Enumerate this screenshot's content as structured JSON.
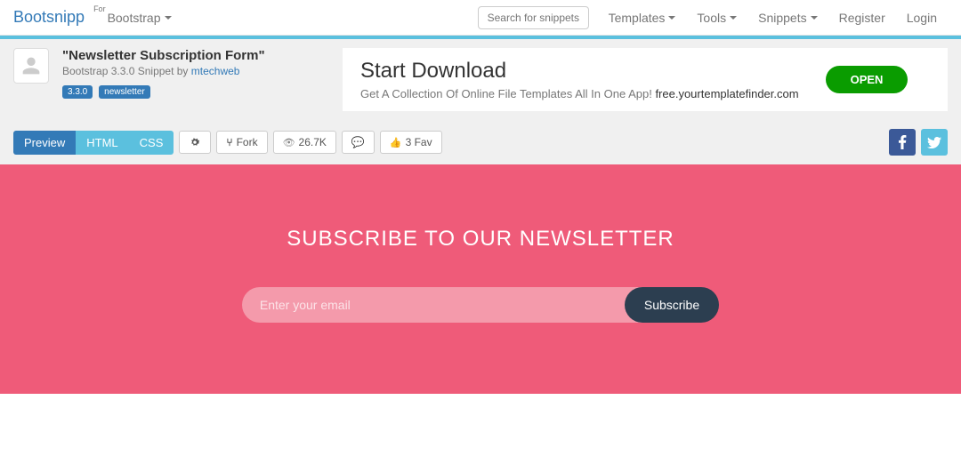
{
  "nav": {
    "brand": "Bootsnipp",
    "for": "For",
    "bootstrap": "Bootstrap",
    "search_placeholder": "Search for snippets",
    "items": [
      "Templates",
      "Tools",
      "Snippets",
      "Register",
      "Login"
    ]
  },
  "snippet": {
    "title": "\"Newsletter Subscription Form\"",
    "sub_prefix": "Bootstrap 3.3.0 Snippet by ",
    "author": "mtechweb",
    "tags": [
      "3.3.0",
      "newsletter"
    ]
  },
  "ad": {
    "title": "Start Download",
    "text": "Get A Collection Of Online File Templates All In One App! ",
    "domain": "free.yourtemplatefinder.com",
    "cta": "OPEN"
  },
  "toolbar": {
    "preview": "Preview",
    "html": "HTML",
    "css": "CSS",
    "fork": "Fork",
    "views": "26.7K",
    "fav": "3 Fav"
  },
  "preview": {
    "heading": "SUBSCRIBE TO OUR NEWSLETTER",
    "placeholder": "Enter your email",
    "button": "Subscribe"
  }
}
